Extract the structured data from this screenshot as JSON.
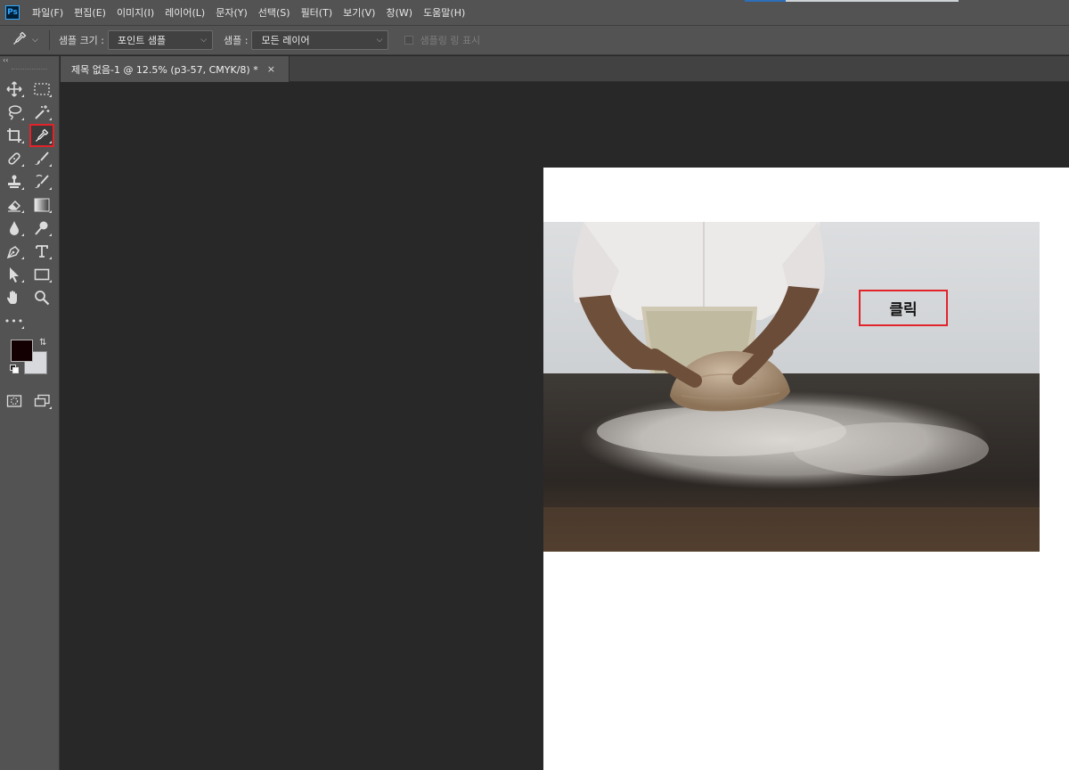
{
  "app": {
    "logo": "Ps"
  },
  "menu": [
    "파일(F)",
    "편집(E)",
    "이미지(I)",
    "레이어(L)",
    "문자(Y)",
    "선택(S)",
    "필터(T)",
    "보기(V)",
    "창(W)",
    "도움말(H)"
  ],
  "options": {
    "tool_icon": "eyedropper-icon",
    "sample_size_label": "샘플 크기 :",
    "sample_size_value": "포인트 샘플",
    "sample_label": "샘플 :",
    "sample_value": "모든 레이어",
    "show_sampling_ring": "샘플링 링 표시"
  },
  "tab": {
    "title": "제목 없음-1 @ 12.5% (p3-57, CMYK/8) *",
    "close": "×"
  },
  "toolbar": {
    "collapse": "‹‹",
    "more": "•••",
    "selected_tool": "eyedropper",
    "foreground_color": "#120002",
    "background_color": "#d7d9dc"
  },
  "canvas": {
    "callout_text": "클릭",
    "callout_color": "#e2232a",
    "photo_subject": "baker kneading dough on floured wooden table"
  }
}
